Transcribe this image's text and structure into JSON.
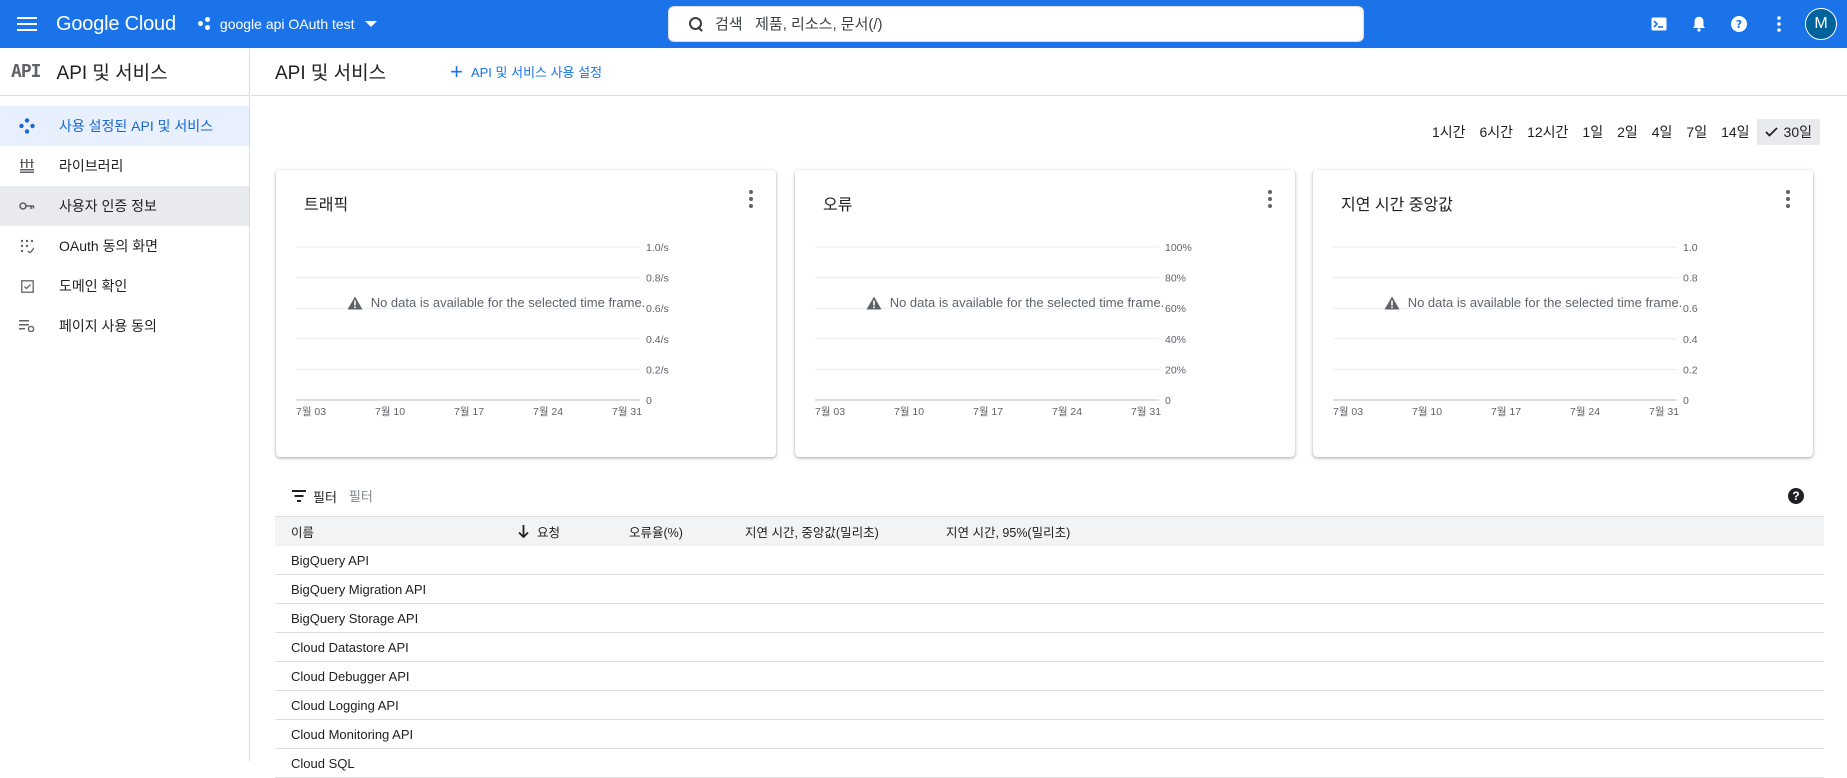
{
  "topbar": {
    "logo": "Google Cloud",
    "project": "google api OAuth test",
    "search_placeholder": "검색   제품, 리소스, 문서(/)",
    "avatar_letter": "M"
  },
  "sidebar": {
    "api_badge": "API",
    "title": "API 및 서비스",
    "items": [
      {
        "label": "사용 설정된 API 및 서비스",
        "icon": "diamond-dots-icon"
      },
      {
        "label": "라이브러리",
        "icon": "library-icon"
      },
      {
        "label": "사용자 인증 정보",
        "icon": "key-icon"
      },
      {
        "label": "OAuth 동의 화면",
        "icon": "consent-icon"
      },
      {
        "label": "도메인 확인",
        "icon": "check-box-icon"
      },
      {
        "label": "페이지 사용 동의",
        "icon": "list-settings-icon"
      }
    ]
  },
  "main": {
    "title": "API 및 서비스",
    "enable_button": "API 및 서비스 사용 설정",
    "time_ranges": [
      "1시간",
      "6시간",
      "12시간",
      "1일",
      "2일",
      "4일",
      "7일",
      "14일",
      "30일"
    ],
    "selected_range": "30일",
    "no_data": "No data is available for the selected time frame.",
    "filter_label": "필터",
    "filter_placeholder": "필터",
    "help_symbol": "?"
  },
  "chart_data": [
    {
      "type": "line",
      "title": "트래픽",
      "x_ticks": [
        "7월 03",
        "7월 10",
        "7월 17",
        "7월 24",
        "7월 31"
      ],
      "y_ticks": [
        "0",
        "0.2/s",
        "0.4/s",
        "0.6/s",
        "0.8/s",
        "1.0/s"
      ],
      "ylim": [
        0,
        1.0
      ],
      "series": []
    },
    {
      "type": "line",
      "title": "오류",
      "x_ticks": [
        "7월 03",
        "7월 10",
        "7월 17",
        "7월 24",
        "7월 31"
      ],
      "y_ticks": [
        "0",
        "20%",
        "40%",
        "60%",
        "80%",
        "100%"
      ],
      "ylim": [
        0,
        100
      ],
      "series": []
    },
    {
      "type": "line",
      "title": "지연 시간 중앙값",
      "x_ticks": [
        "7월 03",
        "7월 10",
        "7월 17",
        "7월 24",
        "7월 31"
      ],
      "y_ticks": [
        "0",
        "0.2",
        "0.4",
        "0.6",
        "0.8",
        "1.0"
      ],
      "ylim": [
        0,
        1.0
      ],
      "series": []
    }
  ],
  "table": {
    "columns": {
      "name": "이름",
      "requests": "요청",
      "error_rate": "오류율(%)",
      "latency_median": "지연 시간, 중앙값(밀리초)",
      "latency_95": "지연 시간, 95%(밀리초)"
    },
    "rows": [
      "BigQuery API",
      "BigQuery Migration API",
      "BigQuery Storage API",
      "Cloud Datastore API",
      "Cloud Debugger API",
      "Cloud Logging API",
      "Cloud Monitoring API",
      "Cloud SQL"
    ]
  },
  "colors": {
    "brand_blue": "#1a73e8",
    "active_nav_bg": "#e8f0fe",
    "active_nav_text": "#1967d2"
  }
}
